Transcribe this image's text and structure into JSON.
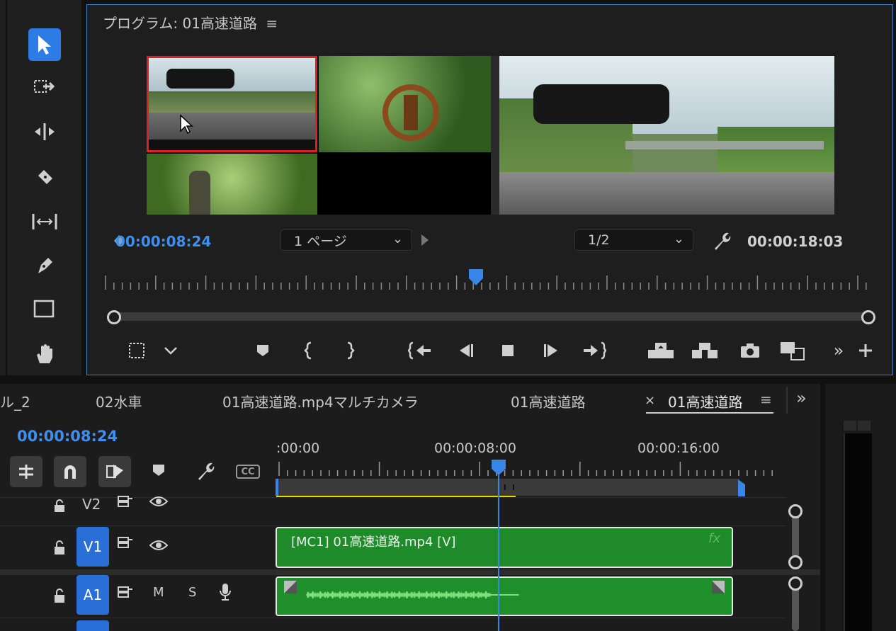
{
  "colors": {
    "accent": "#2d7be5",
    "timecode": "#3f8ff0",
    "clip_video": "#1f8a2a",
    "clip_audio": "#1e8f2a",
    "playhead": "#3a86e8",
    "selection": "#e02020",
    "work_area": "#e8d400"
  },
  "icons": [
    "selection-tool",
    "track-select-forward-tool",
    "ripple-edit-tool",
    "razor-tool",
    "slip-tool",
    "pen-tool",
    "rectangle-tool",
    "hand-tool"
  ],
  "monitor": {
    "title": "プログラム: 01高速道路",
    "menu_icon": "≡",
    "timecode_current": "00:00:08:24",
    "timecode_duration": "00:00:18:03",
    "page_dropdown": "1 ページ",
    "resolution_dropdown": "1/2"
  },
  "timeline": {
    "tabs": [
      "ル_2",
      "02水車",
      "01高速道路.mp4マルチカメラ",
      "01高速道路",
      "01高速道路"
    ],
    "close_glyph": "×",
    "more_glyph": "»",
    "timecode": "00:00:08:24",
    "ruler_labels": [
      ":00:00",
      "00:00:08:00",
      "00:00:16:00"
    ],
    "tracks": [
      {
        "name": "V2"
      },
      {
        "name": "V1"
      },
      {
        "name": "A1",
        "mute": "M",
        "solo": "S"
      }
    ],
    "clips": {
      "video_label": "[MC1] 01高速道路.mp4 [V]",
      "fx": "fx"
    },
    "cc_label": "CC"
  }
}
